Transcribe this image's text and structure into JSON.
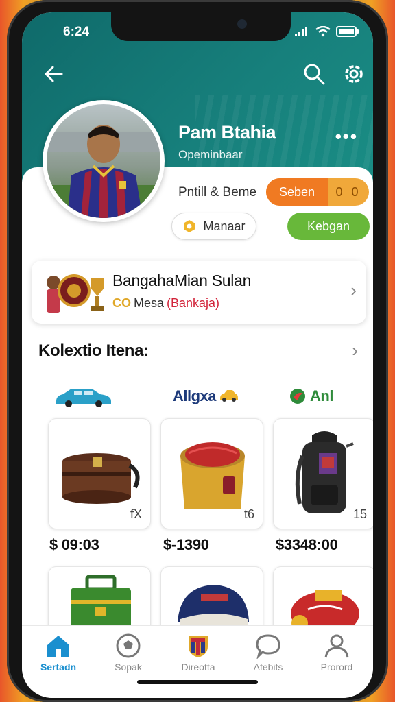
{
  "status": {
    "time": "6:24"
  },
  "profile": {
    "name": "Pam Btahia",
    "subtitle": "Opeminbaar",
    "stat_label": "Pntill & Beme",
    "orange_pill": {
      "label": "Seben",
      "value": "0 0"
    },
    "manage_label": "Manaar",
    "green_label": "Kebgan"
  },
  "achievement": {
    "title": "BangahaMian Sulan",
    "sub_icons": "CO",
    "sub_text": "Mesa",
    "sub_highlight": "(Bankaja)"
  },
  "collection": {
    "title": "Kolextio Itena:",
    "categories": [
      {
        "label": "",
        "icon": "car-icon"
      },
      {
        "label": "Allgxa",
        "icon": "car-icon"
      },
      {
        "label": "Anl",
        "icon": "bird-icon"
      }
    ],
    "items": [
      {
        "name": "chest",
        "count": "fX",
        "price": "$ 09:03"
      },
      {
        "name": "ball-box",
        "count": "t6",
        "price": "$-1390"
      },
      {
        "name": "backpack",
        "count": "15",
        "price": "$3348:00"
      }
    ]
  },
  "nav": {
    "items": [
      {
        "label": "Sertadn",
        "icon": "home-icon",
        "active": true
      },
      {
        "label": "Sopak",
        "icon": "soccer-ball-icon",
        "active": false
      },
      {
        "label": "Direotta",
        "icon": "club-crest-icon",
        "active": false
      },
      {
        "label": "Afebits",
        "icon": "chat-icon",
        "active": false
      },
      {
        "label": "Prorord",
        "icon": "profile-icon",
        "active": false
      }
    ]
  },
  "colors": {
    "teal": "#17807c",
    "orange": "#f07a22",
    "green": "#68b83a",
    "nav_active": "#1a8fcf"
  }
}
